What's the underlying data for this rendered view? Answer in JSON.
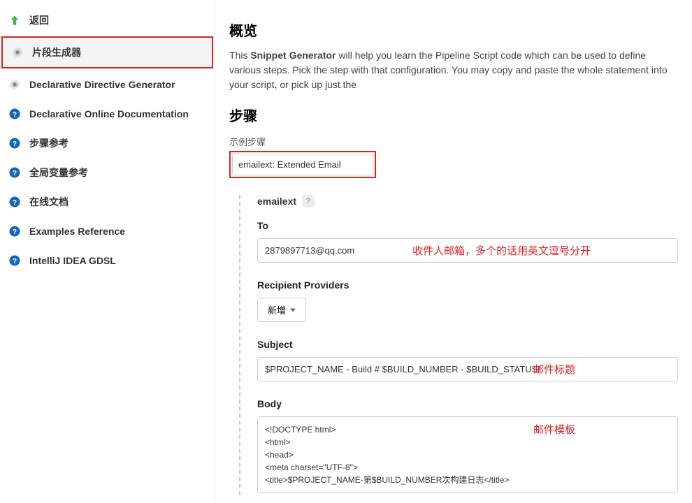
{
  "sidebar": {
    "items": [
      {
        "label": "返回"
      },
      {
        "label": "片段生成器"
      },
      {
        "label": "Declarative Directive Generator"
      },
      {
        "label": "Declarative Online Documentation"
      },
      {
        "label": "步骤参考"
      },
      {
        "label": "全局变量参考"
      },
      {
        "label": "在线文档"
      },
      {
        "label": "Examples Reference"
      },
      {
        "label": "IntelliJ IDEA GDSL"
      }
    ]
  },
  "main": {
    "overview_title": "概览",
    "desc_prefix": "This ",
    "desc_bold": "Snippet Generator",
    "desc_rest": " will help you learn the Pipeline Script code which can be used to define various steps. Pick the step with that configuration. You may copy and paste the whole statement into your script, or pick up just the",
    "steps_title": "步骤",
    "example_label": "示例步骤",
    "dropdown_value": "emailext: Extended Email",
    "block_title": "emailext",
    "help_mark": "?",
    "to": {
      "label": "To",
      "value": "2879897713@qq.com",
      "annotation": "收件人邮箱，多个的话用英文逗号分开"
    },
    "recipients": {
      "label": "Recipient Providers",
      "add_btn": "新增"
    },
    "subject": {
      "label": "Subject",
      "value": "$PROJECT_NAME - Build # $BUILD_NUMBER - $BUILD_STATUS!",
      "annotation": "邮件标题"
    },
    "body": {
      "label": "Body",
      "value": "<!DOCTYPE html>\n<html>\n<head>\n<meta charset=\"UTF-8\">\n<title>$PROJECT_NAME-第$BUILD_NUMBER次构建日志</title>",
      "annotation": "邮件模板"
    }
  }
}
